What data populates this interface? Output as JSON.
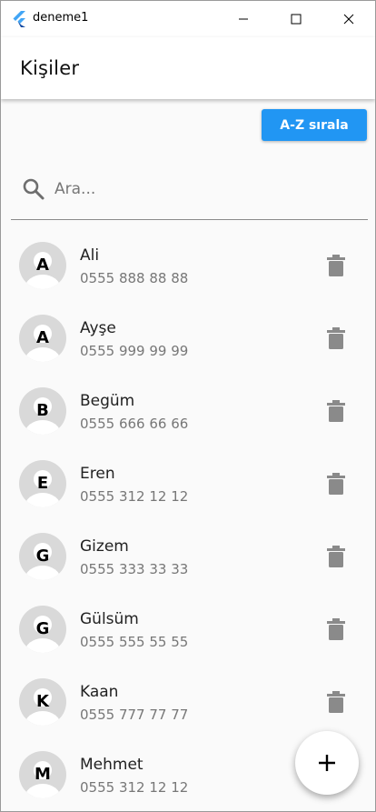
{
  "window": {
    "title": "deneme1"
  },
  "appbar": {
    "title": "Kişiler"
  },
  "toolbar": {
    "sort_label": "A-Z sırala"
  },
  "search": {
    "placeholder": "Ara..."
  },
  "contacts": [
    {
      "initial": "A",
      "name": "Ali",
      "phone": "0555 888 88 88"
    },
    {
      "initial": "A",
      "name": "Ayşe",
      "phone": "0555 999 99 99"
    },
    {
      "initial": "B",
      "name": "Begüm",
      "phone": "0555 666 66 66"
    },
    {
      "initial": "E",
      "name": "Eren",
      "phone": "0555 312 12 12"
    },
    {
      "initial": "G",
      "name": "Gizem",
      "phone": "0555 333 33 33"
    },
    {
      "initial": "G",
      "name": "Gülsüm",
      "phone": "0555 555 55 55"
    },
    {
      "initial": "K",
      "name": "Kaan",
      "phone": "0555 777 77 77"
    },
    {
      "initial": "M",
      "name": "Mehmet",
      "phone": "0555 312 12 12"
    }
  ],
  "colors": {
    "accent": "#2196f3",
    "trash": "#8a8a8a",
    "avatar_bg": "#d9d9d9"
  },
  "icons": {
    "app": "flutter-logo-icon",
    "search": "search-icon",
    "delete": "trash-icon",
    "add": "plus-icon"
  }
}
